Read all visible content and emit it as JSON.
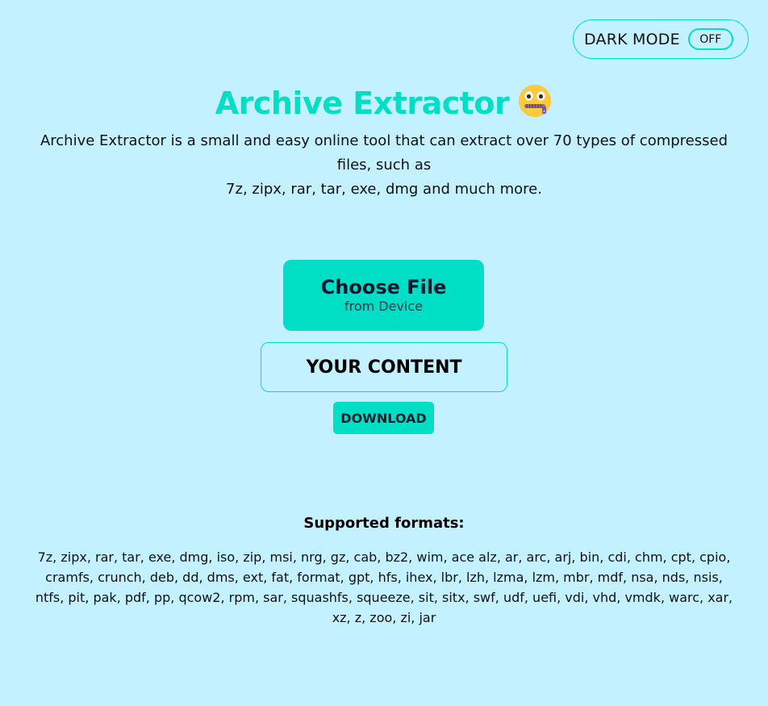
{
  "dark_mode": {
    "label": "DARK MODE",
    "state": "OFF"
  },
  "header": {
    "title": "Archive Extractor"
  },
  "description": {
    "line1": "Archive Extractor is a small and easy online tool that can extract over 70 types of compressed files, such as",
    "line2": "7z, zipx, rar, tar, exe, dmg and much more."
  },
  "choose_file": {
    "label": "Choose File",
    "sublabel": "from Device"
  },
  "content_box": {
    "label": "YOUR CONTENT"
  },
  "download": {
    "label": "DOWNLOAD"
  },
  "formats": {
    "heading": "Supported formats:",
    "list": "7z, zipx, rar, tar, exe, dmg, iso, zip, msi, nrg, gz, cab, bz2, wim, ace alz, ar, arc, arj, bin, cdi, chm, cpt, cpio, cramfs, crunch, deb, dd, dms, ext, fat, format, gpt, hfs, ihex, lbr, lzh, lzma, lzm, mbr, mdf, nsa, nds, nsis, ntfs, pit, pak, pdf, pp, qcow2, rpm, sar, squashfs, squeeze, sit, sitx, swf, udf, uefi, vdi, vhd, vmdk, warc, xar, xz, z, zoo, zi, jar"
  },
  "icons": {
    "title_emoji": "zipper-mouth-face-icon"
  },
  "colors": {
    "background": "#c3f1ff",
    "accent": "#00dfc6",
    "text": "#111111"
  }
}
